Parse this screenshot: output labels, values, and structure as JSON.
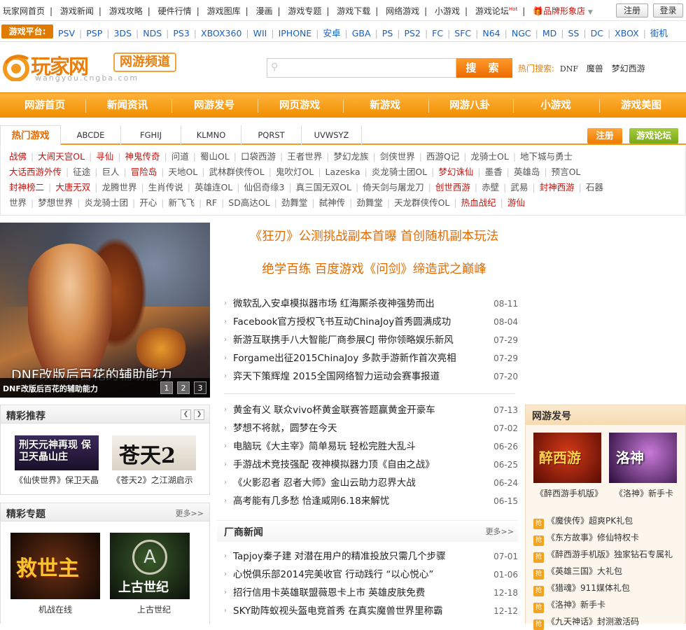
{
  "topnav": {
    "links": [
      "玩家网首页",
      "游戏新闻",
      "游戏攻略",
      "硬件行情",
      "游戏图库",
      "漫画",
      "游戏专题",
      "游戏下载",
      "网络游戏",
      "小游戏"
    ],
    "forum": "游戏论坛",
    "forum_badge": "Hot",
    "brand_store": "品牌形象店",
    "register": "注册",
    "login": "登录"
  },
  "platforms": {
    "label": "游戏平台:",
    "items": [
      "PSV",
      "PSP",
      "3DS",
      "NDS",
      "PS3",
      "XBOX360",
      "WII",
      "IPHONE",
      "安卓",
      "GBA",
      "PS",
      "PS2",
      "FC",
      "SFC",
      "N64",
      "NGC",
      "MD",
      "SS",
      "DC",
      "XBOX",
      "街机"
    ]
  },
  "logo": {
    "main": "玩家网",
    "sub": "网游频道",
    "url": "wangyou.cngba.com"
  },
  "search": {
    "placeholder": "",
    "button": "搜 索",
    "hot_label": "热门搜索:",
    "hot_items": [
      "DNF",
      "魔兽",
      "梦幻西游"
    ]
  },
  "mainnav": [
    "网游首页",
    "新闻资讯",
    "网游发号",
    "网页游戏",
    "新游戏",
    "网游八卦",
    "小游戏",
    "游戏美图"
  ],
  "gametabs": {
    "active": "热门游戏",
    "tabs": [
      "ABCDE",
      "FGHIJ",
      "KLMNO",
      "PQRST",
      "UVWSYZ"
    ],
    "register": "注册",
    "forum": "游戏论坛"
  },
  "gamelist": [
    [
      [
        "战佛",
        "r"
      ],
      [
        "大闹天宫OL",
        "r"
      ],
      [
        "寻仙",
        "r"
      ],
      [
        "神鬼传奇",
        "r"
      ],
      [
        "问道",
        "g"
      ],
      [
        "蜀山OL",
        "g"
      ],
      [
        "口袋西游",
        "g"
      ],
      [
        "王者世界",
        "g"
      ],
      [
        "梦幻龙族",
        "g"
      ],
      [
        "剑侠世界",
        "g"
      ],
      [
        "西游Q记",
        "g"
      ],
      [
        "龙骑士OL",
        "g"
      ],
      [
        "地下城与勇士",
        "g"
      ]
    ],
    [
      [
        "大话西游外传",
        "r"
      ],
      [
        "征途",
        "g"
      ],
      [
        "巨人",
        "g"
      ],
      [
        "冒险岛",
        "r"
      ],
      [
        "天地OL",
        "g"
      ],
      [
        "武林群侠传OL",
        "g"
      ],
      [
        "鬼吹灯OL",
        "g"
      ],
      [
        "Lazeska",
        "g"
      ],
      [
        "炎龙骑士团OL",
        "g"
      ],
      [
        "梦幻诛仙",
        "r"
      ],
      [
        "墨香",
        "g"
      ],
      [
        "英雄岛",
        "g"
      ],
      [
        "预言OL",
        "g"
      ]
    ],
    [
      [
        "封神榜二",
        "r"
      ],
      [
        "大唐无双",
        "r"
      ],
      [
        "龙腾世界",
        "g"
      ],
      [
        "生肖传说",
        "g"
      ],
      [
        "英雄连OL",
        "g"
      ],
      [
        "仙侣奇缘3",
        "g"
      ],
      [
        "真三国无双OL",
        "g"
      ],
      [
        "倚天剑与屠龙刀",
        "g"
      ],
      [
        "创世西游",
        "r"
      ],
      [
        "赤壁",
        "g"
      ],
      [
        "武易",
        "g"
      ],
      [
        "封神西游",
        "r"
      ],
      [
        "石器",
        "g"
      ]
    ],
    [
      [
        "世界",
        "g"
      ],
      [
        "梦想世界",
        "g"
      ],
      [
        "炎龙骑士团",
        "g"
      ],
      [
        "开心",
        "g"
      ],
      [
        "新飞飞",
        "g"
      ],
      [
        "RF",
        "g"
      ],
      [
        "SD高达OL",
        "g"
      ],
      [
        "劲舞堂",
        "g"
      ],
      [
        "弑神传",
        "g"
      ],
      [
        "劲舞堂",
        "g"
      ],
      [
        "天龙群侠传OL",
        "g"
      ],
      [
        "热血战纪",
        "r"
      ],
      [
        "游仙",
        "r"
      ]
    ]
  ],
  "banner": {
    "big_caption": "DNF改版后百花的辅助能力",
    "caption": "DNF改版后百花的辅助能力",
    "pages": [
      "1",
      "2",
      "3"
    ]
  },
  "headlines": [
    "《狂刃》公测挑战副本首曝 首创随机副本玩法",
    "绝学百练 百度游戏《问剑》缔造武之巅峰"
  ],
  "news1": [
    {
      "t": "微软乱入安卓模拟器市场 红海厮杀夜神强势而出",
      "d": "08-11"
    },
    {
      "t": "Facebook官方授权飞书互动ChinaJoy首秀圆满成功",
      "d": "08-04"
    },
    {
      "t": "新游互联携手八大智能厂商参展CJ 带你领略娱乐新风",
      "d": "07-29"
    },
    {
      "t": "Forgame出征2015ChinaJoy 多款手游新作首次亮相",
      "d": "07-29"
    },
    {
      "t": "弈天下策辉煌 2015全国网络智力运动会赛事报道",
      "d": "07-20"
    }
  ],
  "news2": [
    {
      "t": "黄金有义 联众vivo杯黄金联赛答题赢黄金开豪车",
      "d": "07-13"
    },
    {
      "t": "梦想不将就，圆梦在今天",
      "d": "07-02"
    },
    {
      "t": "电脑玩《大主宰》简单易玩 轻松完胜大乱斗",
      "d": "06-26"
    },
    {
      "t": "手游战术竞技强配 夜神模拟器力顶《自由之战》",
      "d": "06-25"
    },
    {
      "t": "《火影忍者 忍者大师》金山云助力忍界大战",
      "d": "06-24"
    },
    {
      "t": "高考能有几多愁 恰逢威刚6.18来解忧",
      "d": "06-15"
    }
  ],
  "vendor": {
    "title": "厂商新闻",
    "more": "更多>>",
    "items": [
      {
        "t": "Tapjoy秦子建 对潜在用户的精准投放只需几个步骤",
        "d": "07-01"
      },
      {
        "t": "心悦俱乐部2014完美收官 行动践行 “以心悦心”",
        "d": "01-06"
      },
      {
        "t": "招行信用卡英雄联盟薇恩卡上市 英雄皮肤免费",
        "d": "12-18"
      },
      {
        "t": "SKY助阵蚁视头盔电竞首秀 在真实魔兽世界里称霸",
        "d": "12-12"
      }
    ]
  },
  "recommend": {
    "title": "精彩推荐",
    "items": [
      {
        "caption": "《仙侠世界》保卫天晶",
        "art": "刑天元神再现 保卫天晶山庄"
      },
      {
        "caption": "《苍天2》之江湖启示",
        "art": "苍天2"
      }
    ]
  },
  "topics": {
    "title": "精彩专题",
    "more": "更多>>",
    "items": [
      {
        "caption": "机战在线",
        "art": "救世主"
      },
      {
        "caption": "上古世纪",
        "art": "上古世纪"
      }
    ]
  },
  "codes": {
    "title": "网游发号",
    "items": [
      {
        "caption": "《醉西游手机版》",
        "art": "醉西游"
      },
      {
        "caption": "《洛神》新手卡",
        "art": "洛神"
      }
    ],
    "gifts": [
      "《魔侠传》超爽PK礼包",
      "《东方故事》修仙特权卡",
      "《醉西游手机版》独家钻石专属礼",
      "《英雄三国》大礼包",
      "《猎魂》911媒体礼包",
      "《洛神》新手卡",
      "《九天神话》封测激活码"
    ],
    "gift_icon": "抢"
  },
  "colors": {
    "accent": "#f08e00",
    "red": "#c4140f",
    "link": "#1561c5"
  }
}
